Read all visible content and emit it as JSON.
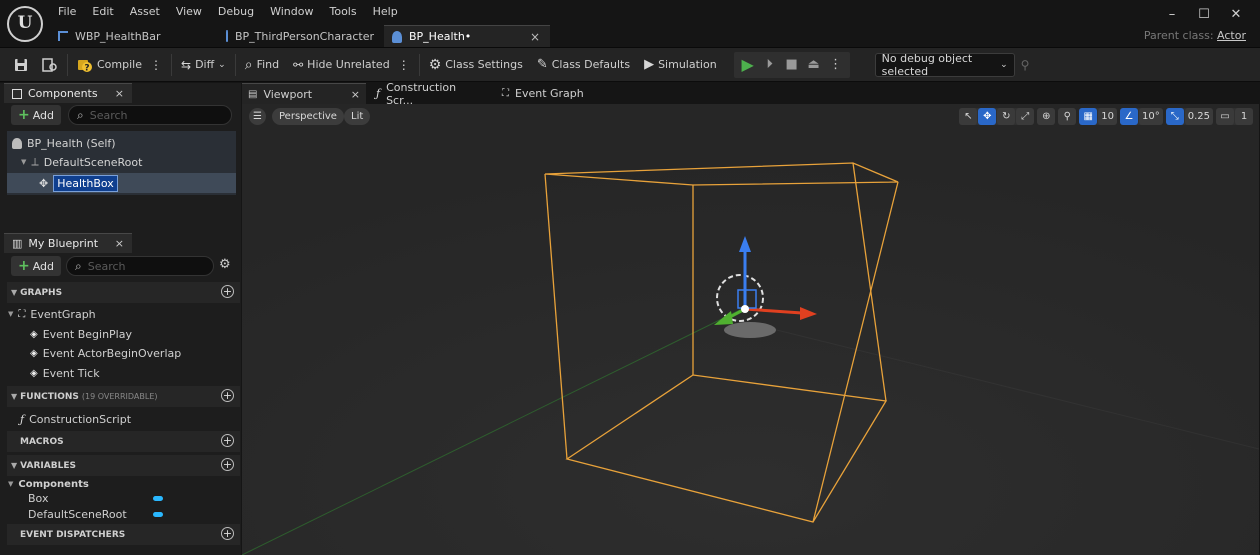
{
  "menu": [
    "File",
    "Edit",
    "Asset",
    "View",
    "Debug",
    "Window",
    "Tools",
    "Help"
  ],
  "window_controls": {
    "minimize": "–",
    "maximize": "☐",
    "close": "✕"
  },
  "logo": "U",
  "doc_tabs": [
    {
      "label": "WBP_HealthBar",
      "icon": "widget-blueprint-icon"
    },
    {
      "label": "BP_ThirdPersonCharacter",
      "icon": "pawn-icon"
    },
    {
      "label": "BP_Health•",
      "icon": "pawn-icon",
      "close": "×"
    }
  ],
  "parent_class": {
    "label": "Parent class:",
    "value": "Actor"
  },
  "toolbar": {
    "compile": "Compile",
    "diff": "Diff",
    "find": "Find",
    "hide_unrelated": "Hide Unrelated",
    "class_settings": "Class Settings",
    "class_defaults": "Class Defaults",
    "simulation": "Simulation",
    "debug_object": "No debug object selected"
  },
  "components_panel": {
    "title": "Components",
    "close": "×",
    "add": "Add",
    "search_placeholder": "Search",
    "tree": [
      {
        "label": "BP_Health (Self)"
      },
      {
        "label": "DefaultSceneRoot"
      },
      {
        "label": "HealthBox",
        "selected": true
      }
    ]
  },
  "my_blueprint": {
    "title": "My Blueprint",
    "close": "×",
    "add": "Add",
    "search_placeholder": "Search",
    "graphs_header": "GRAPHS",
    "event_graph": "EventGraph",
    "events": [
      "Event BeginPlay",
      "Event ActorBeginOverlap",
      "Event Tick"
    ],
    "functions_header": "FUNCTIONS",
    "functions_sub": "(19 OVERRIDABLE)",
    "construction_script": "ConstructionScript",
    "macros_header": "MACROS",
    "variables_header": "VARIABLES",
    "var_category": "Components",
    "variables": [
      "Box",
      "DefaultSceneRoot"
    ],
    "dispatchers_header": "EVENT DISPATCHERS",
    "add_symbol": "+",
    "variable_color": "#2ab8ff"
  },
  "editor_tabs": [
    {
      "label": "Viewport",
      "close": "×"
    },
    {
      "label": "Construction Scr..."
    },
    {
      "label": "Event Graph"
    }
  ],
  "viewport": {
    "perspective": "Perspective",
    "lit": "Lit",
    "grid_size": "10",
    "rotation_snap": "10°",
    "scale_snap": "0.25",
    "camera_speed": "1",
    "box_color": "#e8a23a"
  }
}
